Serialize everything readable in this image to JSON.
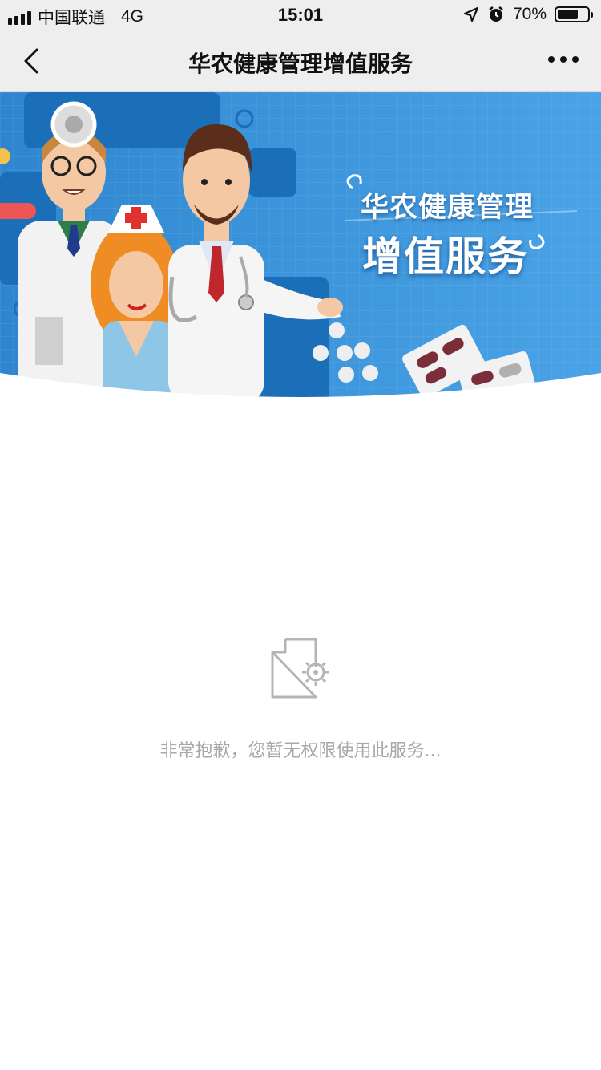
{
  "status_bar": {
    "carrier": "中国联通",
    "network": "4G",
    "time": "15:01",
    "battery": "70%",
    "battery_level": 0.7
  },
  "nav": {
    "title": "华农健康管理增值服务",
    "back_icon": "chevron-left-icon",
    "more_icon": "more-dots-icon"
  },
  "banner": {
    "title": "华农健康管理",
    "subtitle": "增值服务",
    "background_color": "#3b8fd6"
  },
  "empty_state": {
    "icon": "document-gear-icon",
    "message": "非常抱歉，您暂无权限使用此服务..."
  }
}
